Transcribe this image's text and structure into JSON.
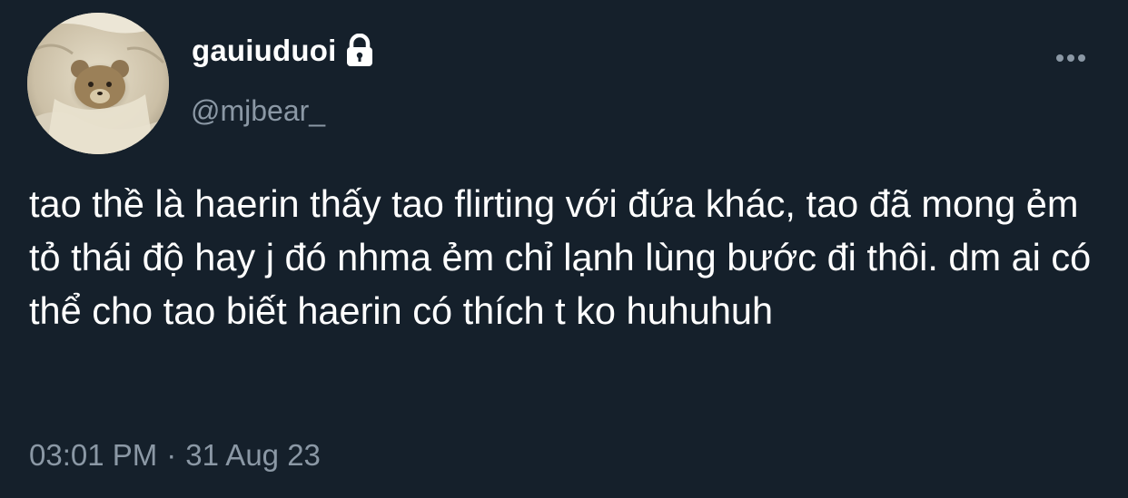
{
  "tweet": {
    "display_name": "gauiuduoi",
    "handle": "@mjbear_",
    "protected_icon": "lock-icon",
    "more_icon": "more-dots-icon",
    "avatar_icon": "teddy-bear-in-blanket-avatar",
    "text": "tao thề là haerin thấy tao flirting với đứa khác, tao đã mong ẻm tỏ thái độ hay j đó nhma ẻm chỉ lạnh lùng bước đi thôi. dm ai có thể cho tao biết haerin có thích t ko huhuhuh",
    "time": "03:01 PM",
    "separator": "·",
    "date": "31 Aug 23"
  },
  "colors": {
    "background": "#15202b",
    "primary_text": "#ffffff",
    "secondary_text": "#8b98a5"
  }
}
